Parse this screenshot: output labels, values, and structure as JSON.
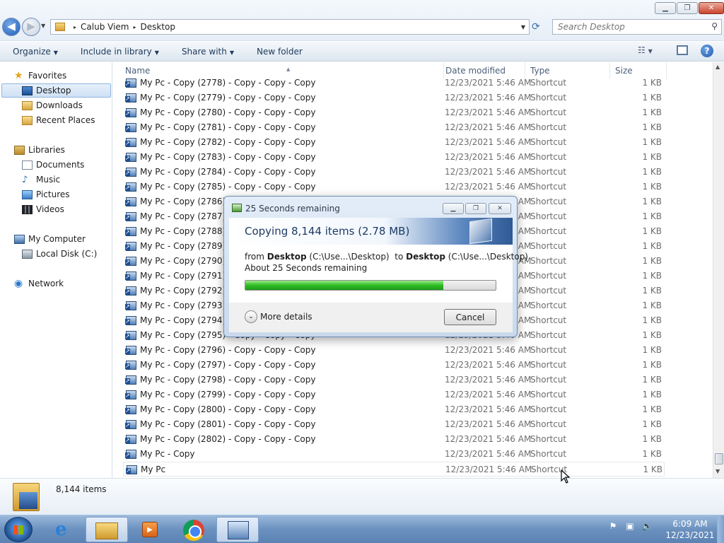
{
  "window": {
    "minimize_glyph": "▁",
    "maximize_glyph": "❐",
    "close_glyph": "✕"
  },
  "address": {
    "crumbs": [
      "Calub Viem",
      "Desktop"
    ],
    "separator": "▸"
  },
  "search": {
    "placeholder": "Search Desktop"
  },
  "toolbar": {
    "organize": "Organize",
    "include_in_library": "Include in library",
    "share_with": "Share with",
    "new_folder": "New folder"
  },
  "nav": {
    "favorites": "Favorites",
    "desktop": "Desktop",
    "downloads": "Downloads",
    "recent_places": "Recent Places",
    "libraries": "Libraries",
    "documents": "Documents",
    "music": "Music",
    "pictures": "Pictures",
    "videos": "Videos",
    "my_computer": "My Computer",
    "local_disk": "Local Disk (C:)",
    "network": "Network"
  },
  "columns": {
    "name": "Name",
    "date": "Date modified",
    "type": "Type",
    "size": "Size"
  },
  "files": [
    {
      "name": "My Pc - Copy (2778) - Copy - Copy - Copy",
      "date": "12/23/2021 5:46 AM",
      "type": "Shortcut",
      "size": "1 KB"
    },
    {
      "name": "My Pc - Copy (2779) - Copy - Copy - Copy",
      "date": "12/23/2021 5:46 AM",
      "type": "Shortcut",
      "size": "1 KB"
    },
    {
      "name": "My Pc - Copy (2780) - Copy - Copy - Copy",
      "date": "12/23/2021 5:46 AM",
      "type": "Shortcut",
      "size": "1 KB"
    },
    {
      "name": "My Pc - Copy (2781) - Copy - Copy - Copy",
      "date": "12/23/2021 5:46 AM",
      "type": "Shortcut",
      "size": "1 KB"
    },
    {
      "name": "My Pc - Copy (2782) - Copy - Copy - Copy",
      "date": "12/23/2021 5:46 AM",
      "type": "Shortcut",
      "size": "1 KB"
    },
    {
      "name": "My Pc - Copy (2783) - Copy - Copy - Copy",
      "date": "12/23/2021 5:46 AM",
      "type": "Shortcut",
      "size": "1 KB"
    },
    {
      "name": "My Pc - Copy (2784) - Copy - Copy - Copy",
      "date": "12/23/2021 5:46 AM",
      "type": "Shortcut",
      "size": "1 KB"
    },
    {
      "name": "My Pc - Copy (2785) - Copy - Copy - Copy",
      "date": "12/23/2021 5:46 AM",
      "type": "Shortcut",
      "size": "1 KB"
    },
    {
      "name": "My Pc - Copy (2786) - Copy - Copy - Copy",
      "date": "12/23/2021 5:46 AM",
      "type": "Shortcut",
      "size": "1 KB"
    },
    {
      "name": "My Pc - Copy (2787) - Copy - Copy - Copy",
      "date": "12/23/2021 5:46 AM",
      "type": "Shortcut",
      "size": "1 KB"
    },
    {
      "name": "My Pc - Copy (2788) - Copy - Copy - Copy",
      "date": "12/23/2021 5:46 AM",
      "type": "Shortcut",
      "size": "1 KB"
    },
    {
      "name": "My Pc - Copy (2789) - Copy - Copy - Copy",
      "date": "12/23/2021 5:46 AM",
      "type": "Shortcut",
      "size": "1 KB"
    },
    {
      "name": "My Pc - Copy (2790) - Copy - Copy - Copy",
      "date": "12/23/2021 5:46 AM",
      "type": "Shortcut",
      "size": "1 KB"
    },
    {
      "name": "My Pc - Copy (2791) - Copy - Copy - Copy",
      "date": "12/23/2021 5:46 AM",
      "type": "Shortcut",
      "size": "1 KB"
    },
    {
      "name": "My Pc - Copy (2792) - Copy - Copy - Copy",
      "date": "12/23/2021 5:46 AM",
      "type": "Shortcut",
      "size": "1 KB"
    },
    {
      "name": "My Pc - Copy (2793) - Copy - Copy - Copy",
      "date": "12/23/2021 5:46 AM",
      "type": "Shortcut",
      "size": "1 KB"
    },
    {
      "name": "My Pc - Copy (2794) - Copy - Copy - Copy",
      "date": "12/23/2021 5:46 AM",
      "type": "Shortcut",
      "size": "1 KB"
    },
    {
      "name": "My Pc - Copy (2795) - Copy - Copy - Copy",
      "date": "12/23/2021 5:46 AM",
      "type": "Shortcut",
      "size": "1 KB"
    },
    {
      "name": "My Pc - Copy (2796) - Copy - Copy - Copy",
      "date": "12/23/2021 5:46 AM",
      "type": "Shortcut",
      "size": "1 KB"
    },
    {
      "name": "My Pc - Copy (2797) - Copy - Copy - Copy",
      "date": "12/23/2021 5:46 AM",
      "type": "Shortcut",
      "size": "1 KB"
    },
    {
      "name": "My Pc - Copy (2798) - Copy - Copy - Copy",
      "date": "12/23/2021 5:46 AM",
      "type": "Shortcut",
      "size": "1 KB"
    },
    {
      "name": "My Pc - Copy (2799) - Copy - Copy - Copy",
      "date": "12/23/2021 5:46 AM",
      "type": "Shortcut",
      "size": "1 KB"
    },
    {
      "name": "My Pc - Copy (2800) - Copy - Copy - Copy",
      "date": "12/23/2021 5:46 AM",
      "type": "Shortcut",
      "size": "1 KB"
    },
    {
      "name": "My Pc - Copy (2801) - Copy - Copy - Copy",
      "date": "12/23/2021 5:46 AM",
      "type": "Shortcut",
      "size": "1 KB"
    },
    {
      "name": "My Pc - Copy (2802) - Copy - Copy - Copy",
      "date": "12/23/2021 5:46 AM",
      "type": "Shortcut",
      "size": "1 KB"
    },
    {
      "name": "My Pc - Copy",
      "date": "12/23/2021 5:46 AM",
      "type": "Shortcut",
      "size": "1 KB"
    },
    {
      "name": "My Pc",
      "date": "12/23/2021 5:46 AM",
      "type": "Shortcut",
      "size": "1 KB"
    }
  ],
  "details": {
    "item_count": "8,144 items"
  },
  "dialog": {
    "title": "25 Seconds remaining",
    "heading": "Copying 8,144 items (2.78 MB)",
    "from_prefix": "from",
    "from_name": "Desktop",
    "from_path": "(C:\\Use...\\Desktop)",
    "to_prefix": "to",
    "to_name": "Desktop",
    "to_path": "(C:\\Use...\\Desktop)",
    "remaining": "About 25 Seconds remaining",
    "progress_percent": 79,
    "more_details": "More details",
    "cancel": "Cancel"
  },
  "taskbar": {
    "ie_glyph": "e",
    "time": "6:09 AM",
    "date": "12/23/2021"
  },
  "colors": {
    "progress_green": "#2ebd24",
    "accent_blue": "#1d5db8",
    "selection": "#cfe1f5"
  }
}
